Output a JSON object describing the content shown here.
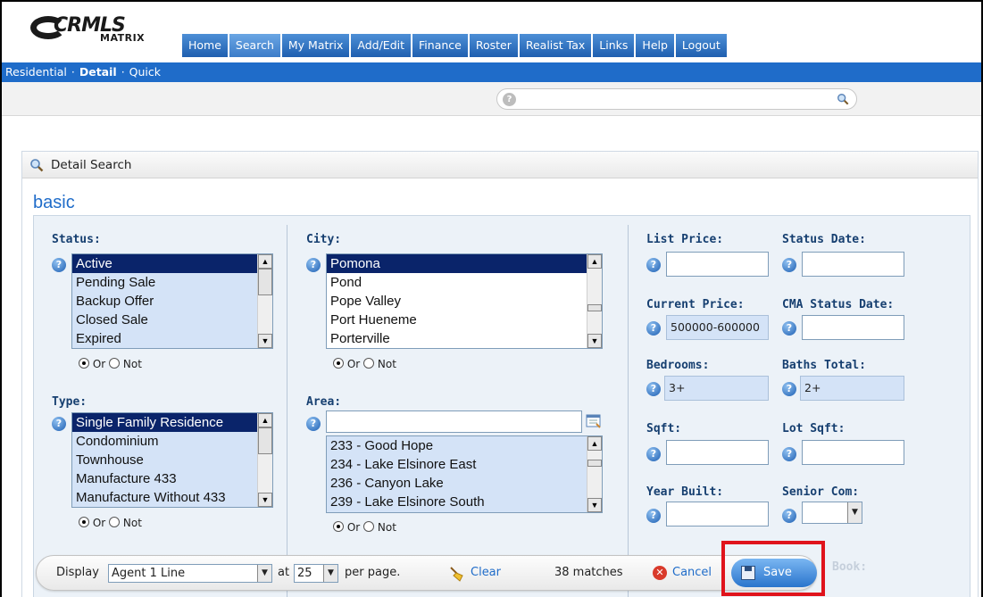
{
  "logo": {
    "text": "CRMLS",
    "subtext": "MATRIX"
  },
  "nav": {
    "tabs": [
      "Home",
      "Search",
      "My Matrix",
      "Add/Edit",
      "Finance",
      "Roster",
      "Realist Tax",
      "Links",
      "Help",
      "Logout"
    ],
    "active": "Search"
  },
  "subnav": {
    "residential": "Residential",
    "detail": "Detail",
    "quick": "Quick"
  },
  "panel": {
    "title": "Detail Search",
    "section": "basic"
  },
  "status": {
    "label": "Status:",
    "options": [
      "Active",
      "Pending Sale",
      "Backup Offer",
      "Closed Sale",
      "Expired"
    ],
    "selected": "Active",
    "or": "Or",
    "not": "Not"
  },
  "type": {
    "label": "Type:",
    "options": [
      "Single Family Residence",
      "Condominium",
      "Townhouse",
      "Manufacture 433",
      "Manufacture Without 433"
    ],
    "selected": "Single Family Residence",
    "or": "Or",
    "not": "Not"
  },
  "city": {
    "label": "City:",
    "options": [
      "Pomona",
      "Pond",
      "Pope Valley",
      "Port Hueneme",
      "Porterville"
    ],
    "selected": "Pomona",
    "or": "Or",
    "not": "Not"
  },
  "area": {
    "label": "Area:",
    "input_value": "",
    "options": [
      "233 - Good Hope",
      "234 - Lake Elsinore East",
      "236 - Canyon Lake",
      "239 - Lake Elsinore South"
    ],
    "or": "Or",
    "not": "Not"
  },
  "fields": {
    "list_price": {
      "label": "List Price:",
      "value": ""
    },
    "status_date": {
      "label": "Status Date:",
      "value": ""
    },
    "current_price": {
      "label": "Current Price:",
      "value": "500000-600000"
    },
    "cma_status_date": {
      "label": "CMA Status Date:",
      "value": ""
    },
    "bedrooms": {
      "label": "Bedrooms:",
      "value": "3+"
    },
    "baths_total": {
      "label": "Baths Total:",
      "value": "2+"
    },
    "sqft": {
      "label": "Sqft:",
      "value": ""
    },
    "lot_sqft": {
      "label": "Lot Sqft:",
      "value": ""
    },
    "year_built": {
      "label": "Year Built:",
      "value": ""
    },
    "senior_com": {
      "label": "Senior Com:",
      "value": ""
    }
  },
  "toolbar": {
    "display_label": "Display",
    "display_value": "Agent 1 Line",
    "at_label": "at",
    "per_page_value": "25",
    "per_page_label": "per page.",
    "clear_label": "Clear",
    "matches": "38 matches",
    "cancel_label": "Cancel",
    "save_label": "Save"
  },
  "colors": {
    "brand": "#1f6cc9",
    "highlight": "#e0141c",
    "selected": "#0a246a"
  }
}
